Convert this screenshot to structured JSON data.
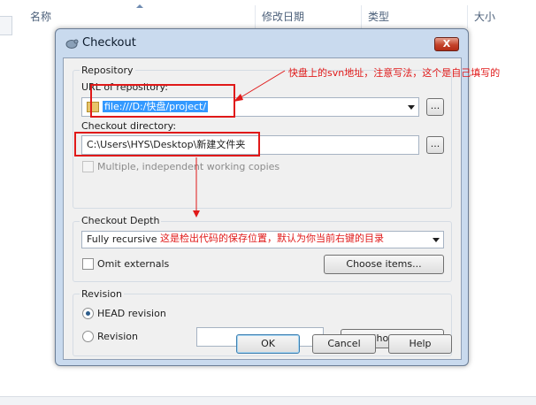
{
  "explorer": {
    "columns": [
      "名称",
      "修改日期",
      "类型",
      "大小"
    ]
  },
  "dialog": {
    "title": "Checkout",
    "close_label": "X",
    "repository": {
      "group_label": "Repository",
      "url_label": "URL of repository:",
      "url_value": "file:///D:/快盘/project/",
      "dir_label": "Checkout directory:",
      "dir_value": "C:\\Users\\HYS\\Desktop\\新建文件夹",
      "browse_label": "...",
      "multiple_label": "Multiple, independent working copies",
      "multiple_checked": false
    },
    "depth": {
      "group_label": "Checkout Depth",
      "selected": "Fully recursive",
      "omit_label": "Omit externals",
      "omit_checked": false,
      "choose_items_label": "Choose items..."
    },
    "revision": {
      "group_label": "Revision",
      "head_label": "HEAD revision",
      "head_checked": true,
      "rev_label": "Revision",
      "rev_value": "",
      "show_log_label": "Show log"
    },
    "buttons": {
      "ok": "OK",
      "cancel": "Cancel",
      "help": "Help"
    }
  },
  "annotations": {
    "url_note": "快盘上的svn地址，注意写法，这个是自己填写的",
    "dir_note": "这是检出代码的保存位置，默认为你当前右键的目录",
    "color": "#e01919"
  }
}
